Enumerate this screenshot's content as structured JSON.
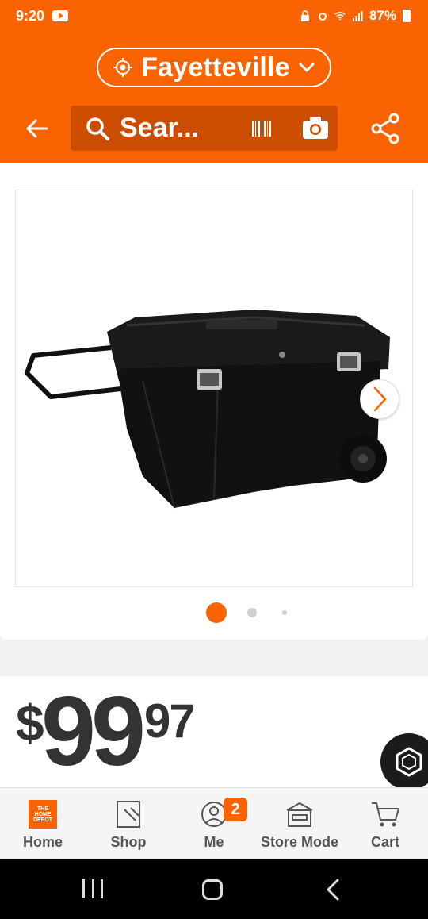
{
  "status_bar": {
    "time": "9:20",
    "battery": "87%"
  },
  "header": {
    "location": "Fayetteville",
    "search_placeholder": "Sear...",
    "accent_color": "#f96302"
  },
  "product_image": {
    "alt": "Black rolling tool chest with extended handle",
    "carousel_dots": 3,
    "active_dot": 0
  },
  "price": {
    "dollar_sign": "$",
    "whole": "99",
    "cents": "97"
  },
  "bottom_nav": {
    "items": [
      {
        "label": "Home",
        "icon": "home-depot-logo-icon"
      },
      {
        "label": "Shop",
        "icon": "shop-bag-icon"
      },
      {
        "label": "Me",
        "icon": "user-icon",
        "badge": "2"
      },
      {
        "label": "Store Mode",
        "icon": "store-icon"
      },
      {
        "label": "Cart",
        "icon": "cart-icon"
      }
    ]
  }
}
